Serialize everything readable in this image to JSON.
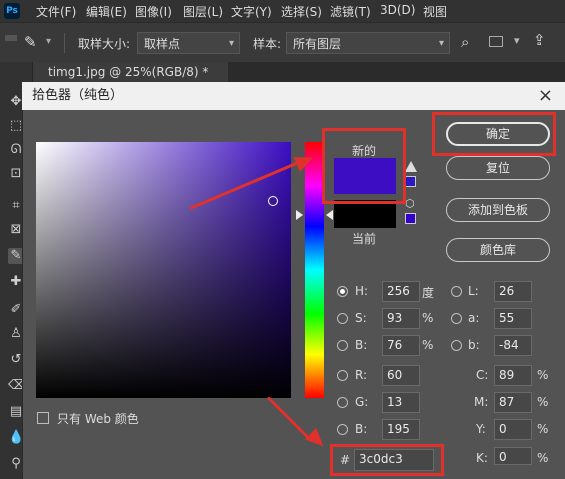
{
  "menubar": {
    "logo": "Ps",
    "items": [
      "文件(F)",
      "编辑(E)",
      "图像(I)",
      "图层(L)",
      "文字(Y)",
      "选择(S)",
      "滤镜(T)",
      "3D(D)",
      "视图"
    ]
  },
  "options": {
    "sample_size_label": "取样大小:",
    "sample_size_value": "取样点",
    "sample_label": "样本:",
    "sample_value": "所有图层"
  },
  "tab": {
    "title": "timg1.jpg @ 25%(RGB/8) *",
    "close": "×"
  },
  "dialog": {
    "title": "拾色器（纯色）",
    "close": "×",
    "new_label": "新的",
    "current_label": "当前",
    "new_color": "#3c0dc3",
    "current_color": "#000000",
    "web_only_label": "只有 Web 颜色",
    "buttons": {
      "ok": "确定",
      "reset": "复位",
      "add_swatch": "添加到色板",
      "color_library": "颜色库"
    },
    "hsb": {
      "h": {
        "label": "H:",
        "value": "256",
        "unit": "度"
      },
      "s": {
        "label": "S:",
        "value": "93",
        "unit": "%"
      },
      "b": {
        "label": "B:",
        "value": "76",
        "unit": "%"
      }
    },
    "rgb": {
      "r": {
        "label": "R:",
        "value": "60"
      },
      "g": {
        "label": "G:",
        "value": "13"
      },
      "b": {
        "label": "B:",
        "value": "195"
      }
    },
    "lab": {
      "l": {
        "label": "L:",
        "value": "26"
      },
      "a": {
        "label": "a:",
        "value": "55"
      },
      "b": {
        "label": "b:",
        "value": "-84"
      }
    },
    "cmyk": {
      "c": {
        "label": "C:",
        "value": "89",
        "unit": "%"
      },
      "m": {
        "label": "M:",
        "value": "87",
        "unit": "%"
      },
      "y": {
        "label": "Y:",
        "value": "0",
        "unit": "%"
      },
      "k": {
        "label": "K:",
        "value": "0",
        "unit": "%"
      }
    },
    "hex": {
      "label": "#",
      "value": "3c0dc3"
    }
  },
  "annotation_color": "#e0312c"
}
